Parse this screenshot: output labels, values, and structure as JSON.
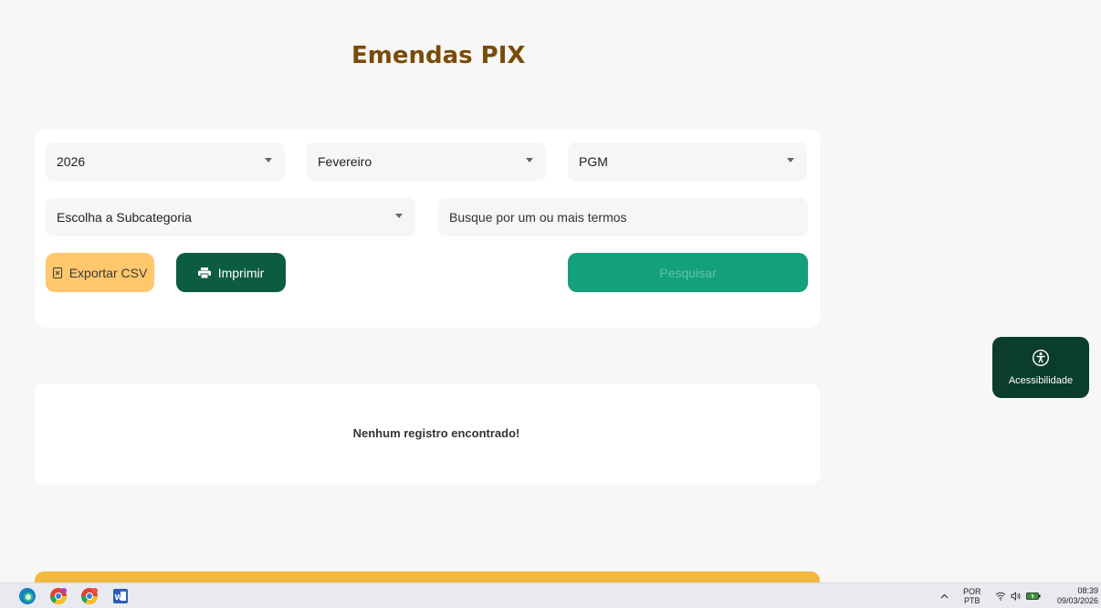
{
  "header": {
    "title": "Emendas PIX"
  },
  "filters": {
    "year": {
      "value": "2026"
    },
    "month": {
      "value": "Fevereiro"
    },
    "organ": {
      "value": "PGM"
    },
    "subcategory": {
      "value": "Escolha a Subcategoria"
    },
    "search": {
      "placeholder": "Busque por um ou mais termos",
      "value": ""
    }
  },
  "actions": {
    "export_csv_label": "Exportar CSV",
    "print_label": "Imprimir",
    "search_label": "Pesquisar"
  },
  "results": {
    "empty_message": "Nenhum registro encontrado!"
  },
  "accessibility": {
    "label": "Acessibilidade"
  },
  "taskbar": {
    "apps": [
      "edge-icon",
      "chrome-icon",
      "chrome-icon",
      "word-icon"
    ],
    "language_top": "POR",
    "language_bottom": "PTB",
    "time": "08:39",
    "date": "09/03/2026"
  },
  "colors": {
    "title": "#7a4b09",
    "csv_button": "#ffc86d",
    "print_button": "#0c5c42",
    "search_button": "#14a07a",
    "accessibility_button": "#0b3d2b",
    "footer_band": "#f2b840"
  }
}
